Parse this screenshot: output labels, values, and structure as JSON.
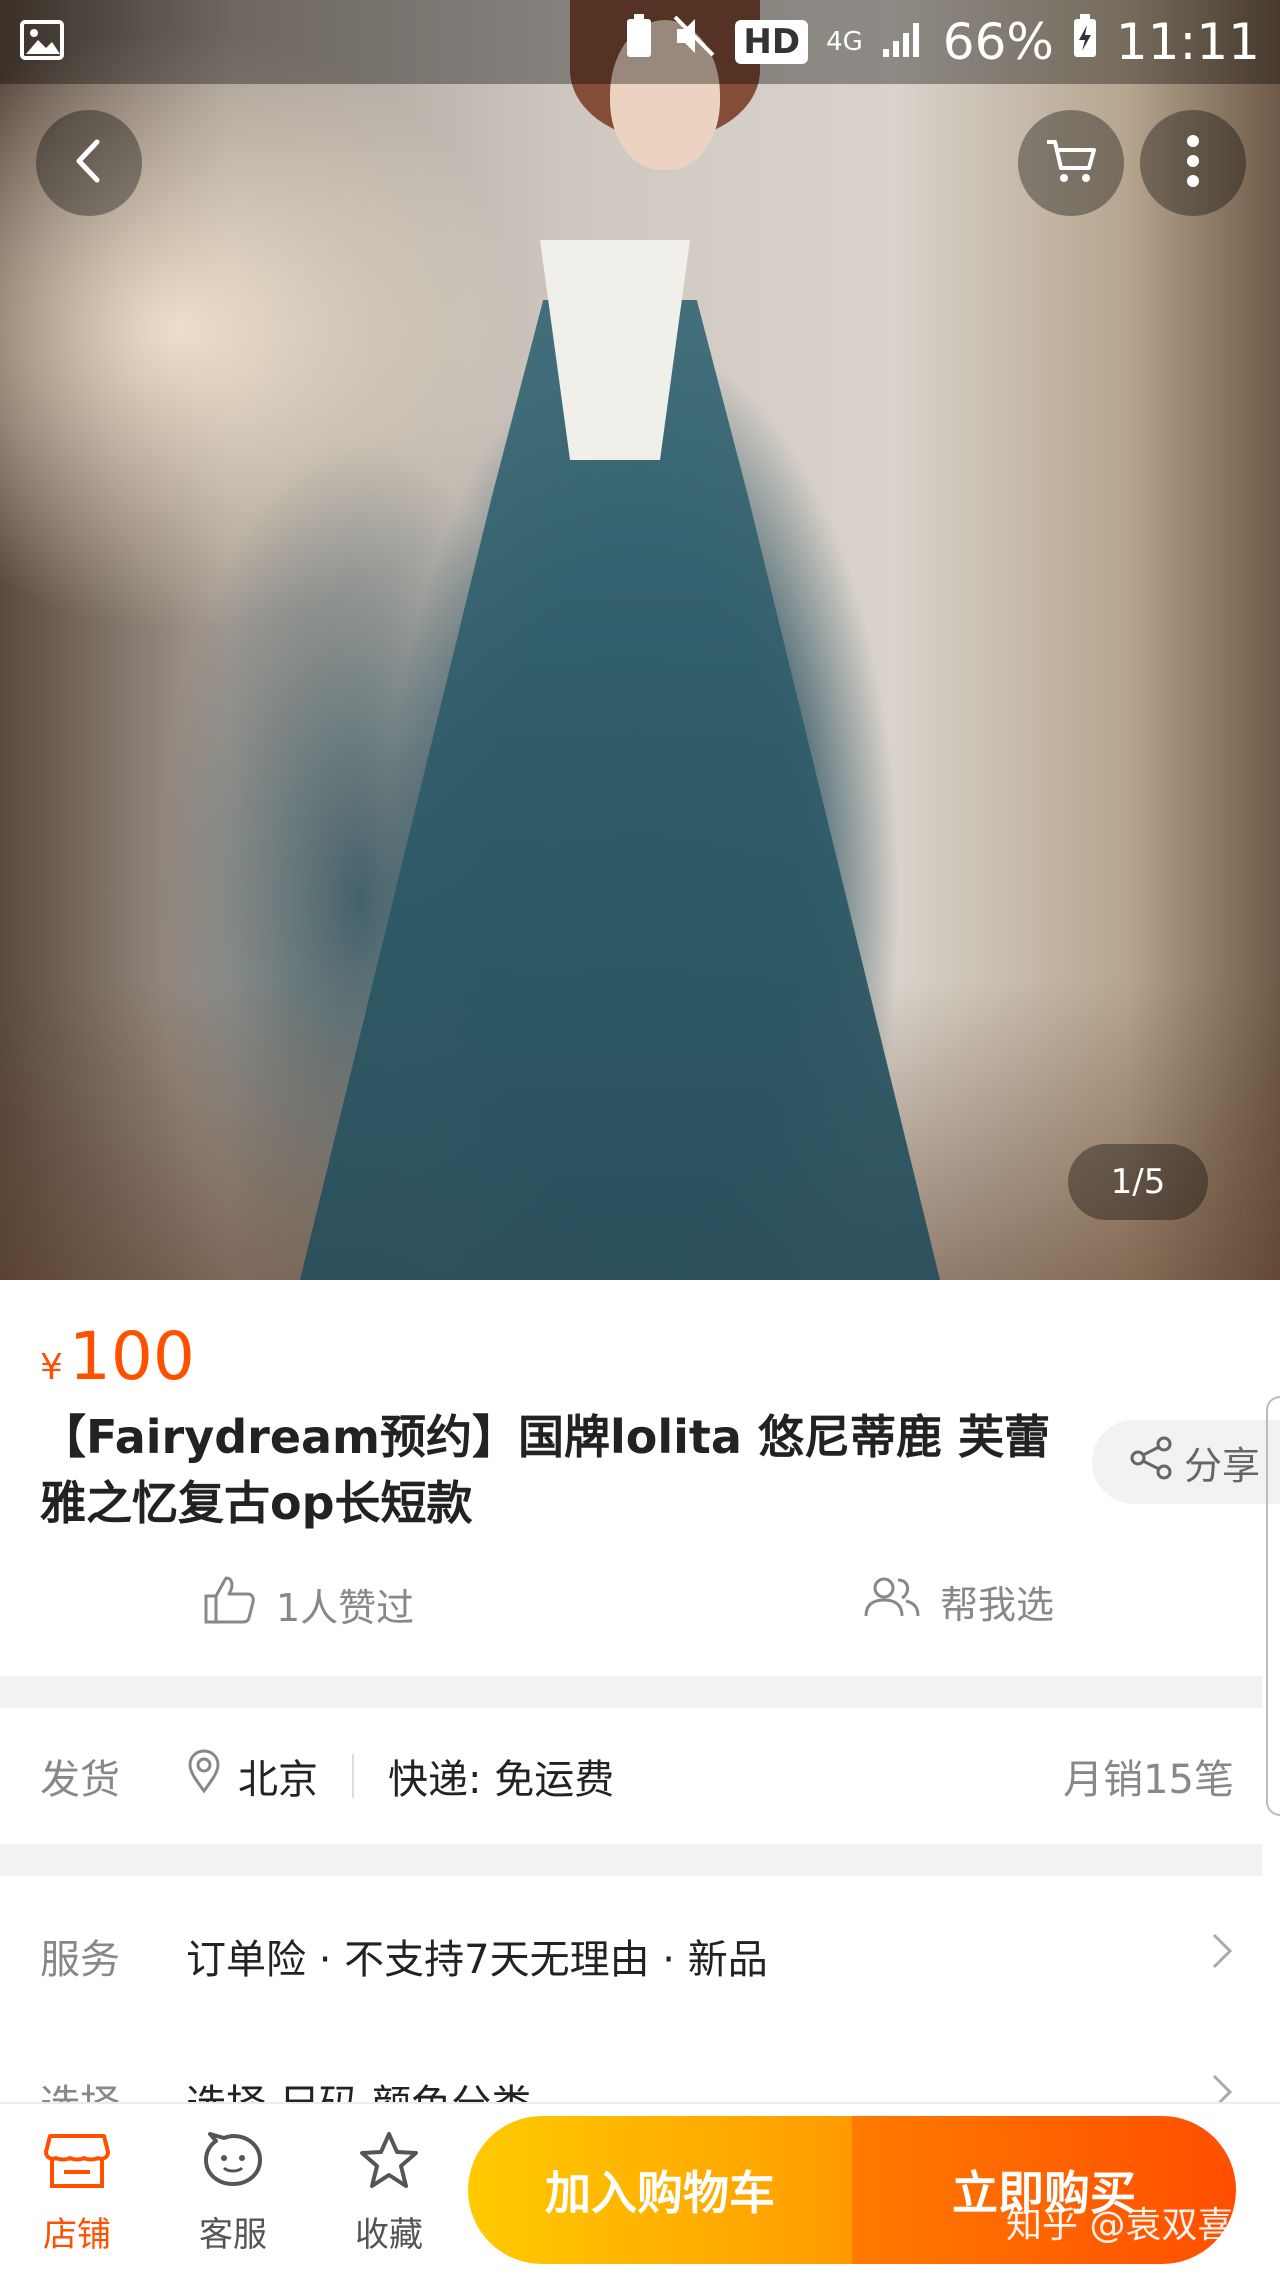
{
  "status_bar": {
    "hd": "HD",
    "network": "4G",
    "battery": "66%",
    "time": "11:11"
  },
  "gallery": {
    "page_indicator": "1/5"
  },
  "product": {
    "currency": "¥",
    "price": "100",
    "title": "【Fairydream预约】国牌lolita 悠尼蒂鹿 芙蕾雅之忆复古op长短款",
    "share_label": "分享",
    "likes_label": "1人赞过",
    "help_label": "帮我选"
  },
  "shipping": {
    "label": "发货",
    "city": "北京",
    "express": "快递: 免运费",
    "monthly_sales": "月销15笔"
  },
  "service": {
    "label": "服务",
    "value": "订单险 · 不支持7天无理由 · 新品"
  },
  "selection": {
    "label": "选择",
    "value": "选择 尺码 颜色分类"
  },
  "bottom_bar": {
    "store": "店铺",
    "customer_service": "客服",
    "favorite": "收藏",
    "add_to_cart": "加入购物车",
    "buy_now": "立即购买"
  },
  "watermark": "知乎 @袁双喜",
  "colors": {
    "accent": "#ff5000",
    "cart_button": "#ffb300",
    "buy_button": "#ff6200"
  }
}
